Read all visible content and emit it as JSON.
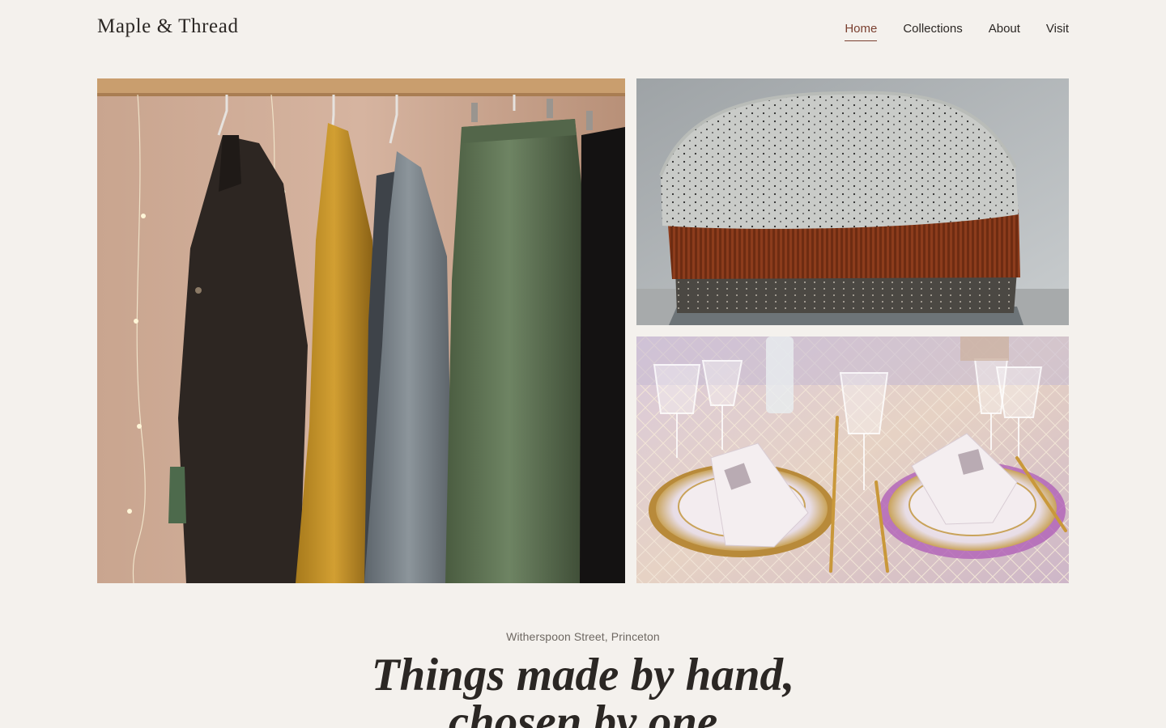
{
  "header": {
    "brand": "Maple & Thread",
    "nav": [
      {
        "label": "Home",
        "active": true
      },
      {
        "label": "Collections",
        "active": false
      },
      {
        "label": "About",
        "active": false
      },
      {
        "label": "Visit",
        "active": false
      }
    ]
  },
  "gallery": {
    "photos": [
      {
        "subject": "linen garments hanging on a wooden clothes rack"
      },
      {
        "subject": "stack of folded knit sweaters"
      },
      {
        "subject": "table setting with crystal glasses and folded napkins on plates"
      }
    ]
  },
  "hero": {
    "location": "Witherspoon Street, Princeton",
    "headline": "Things made by hand,\nchosen by one"
  },
  "colors": {
    "background": "#f4f1ed",
    "text": "#2b2724",
    "accent": "#7a4030",
    "muted": "#6e6862"
  }
}
